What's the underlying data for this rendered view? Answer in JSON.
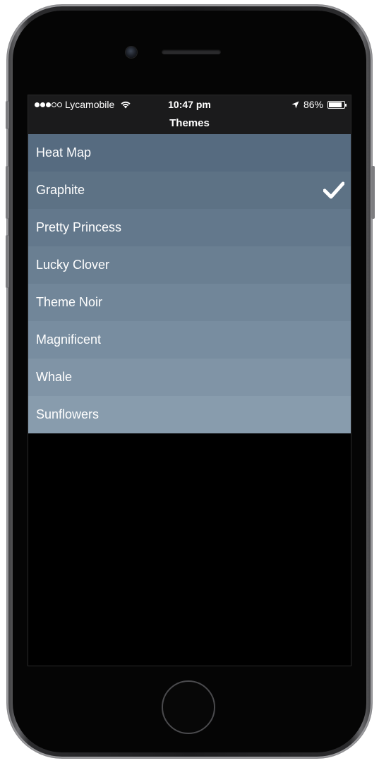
{
  "status_bar": {
    "carrier": "Lycamobile",
    "signal_dots": [
      true,
      true,
      true,
      false,
      false
    ],
    "time": "10:47 pm",
    "battery_percent": "86%",
    "battery_level": 0.86,
    "icons": {
      "wifi": "wifi-icon",
      "location": "location-arrow-icon",
      "battery": "battery-icon"
    }
  },
  "nav": {
    "title": "Themes"
  },
  "themes": {
    "items": [
      {
        "label": "Heat Map",
        "selected": false,
        "color": "#566b80"
      },
      {
        "label": "Graphite",
        "selected": true,
        "color": "#5d7285"
      },
      {
        "label": "Pretty Princess",
        "selected": false,
        "color": "#63788c"
      },
      {
        "label": "Lucky Clover",
        "selected": false,
        "color": "#6a7f92"
      },
      {
        "label": "Theme Noir",
        "selected": false,
        "color": "#718699"
      },
      {
        "label": "Magnificent",
        "selected": false,
        "color": "#788da0"
      },
      {
        "label": "Whale",
        "selected": false,
        "color": "#8094a6"
      },
      {
        "label": "Sunflowers",
        "selected": false,
        "color": "#889cad"
      }
    ],
    "checkmark_icon": "checkmark-icon"
  }
}
